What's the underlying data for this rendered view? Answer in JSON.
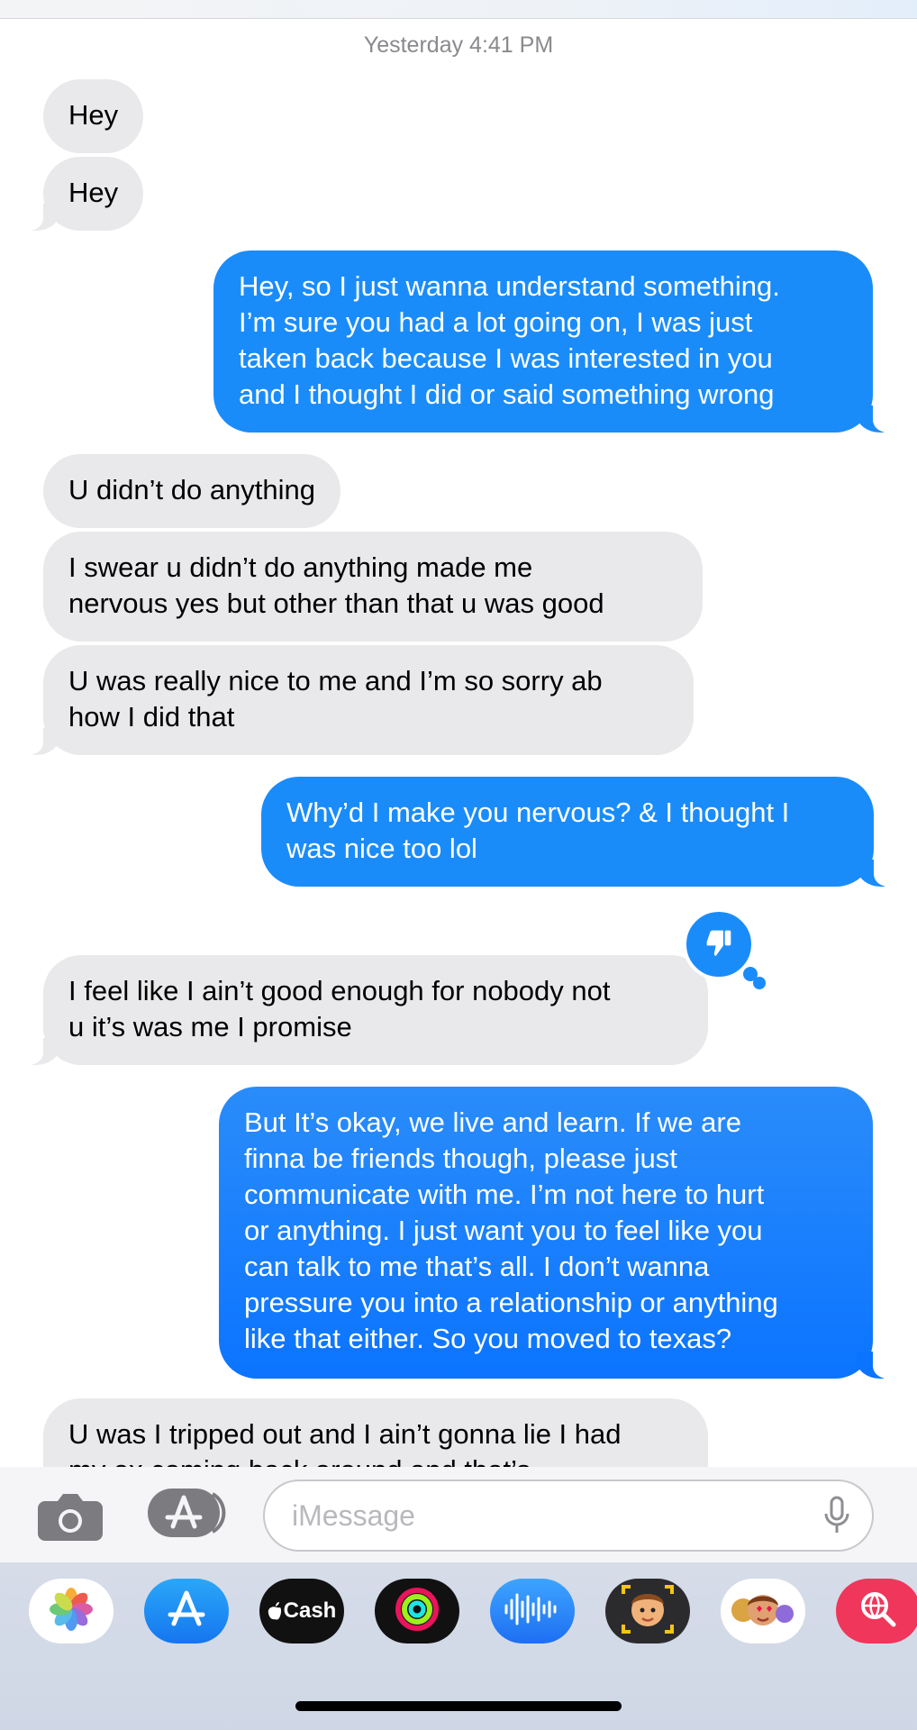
{
  "timestamp": "Yesterday 4:41 PM",
  "messages": [
    {
      "dir": "in",
      "text": "Hey"
    },
    {
      "dir": "in",
      "text": "Hey"
    },
    {
      "dir": "out",
      "text": "Hey, so I just wanna understand something.\nI’m sure you had a lot going on, I was just\ntaken back because I was interested in you\nand I thought I did or said something wrong"
    },
    {
      "dir": "in",
      "text": "U didn’t do anything"
    },
    {
      "dir": "in",
      "text": "I swear u didn’t do anything made me\nnervous yes but other than that u was good"
    },
    {
      "dir": "in",
      "text": "U was really nice to me and I’m so sorry ab\nhow I did that"
    },
    {
      "dir": "out",
      "text": "Why’d I make you nervous? & I thought I\nwas nice too lol"
    },
    {
      "dir": "in",
      "text": "I feel like I ain’t good enough for nobody not\nu it’s was me I promise",
      "reaction": "thumbs-down-icon"
    },
    {
      "dir": "out",
      "text": "But It’s okay, we live and learn. If we are\nfinna be friends though, please just\ncommunicate with me. I’m not here to hurt\nor anything. I just want you to feel like you\ncan talk to me that’s all. I don’t wanna\npressure you into a relationship or anything\nlike that either. So you moved to texas?"
    },
    {
      "dir": "in",
      "text": "U was I tripped out and I ain’t gonna lie I had\nmy ex coming back around and that’s"
    }
  ],
  "input": {
    "placeholder": "iMessage"
  },
  "toolbar": {
    "camera": "camera-icon",
    "apps": "app-store-icon",
    "mic": "microphone-icon"
  },
  "dock_apps": [
    {
      "name": "photos-icon"
    },
    {
      "name": "app-store-icon"
    },
    {
      "name": "cash-icon",
      "label": "Cash"
    },
    {
      "name": "activity-icon"
    },
    {
      "name": "audio-message-icon"
    },
    {
      "name": "memoji-icon"
    },
    {
      "name": "memoji-stickers-icon"
    },
    {
      "name": "image-search-icon"
    }
  ],
  "colors": {
    "outgoing": "#1a8cfa",
    "incoming": "#e9e9eb",
    "accent": "#0b74ff"
  }
}
